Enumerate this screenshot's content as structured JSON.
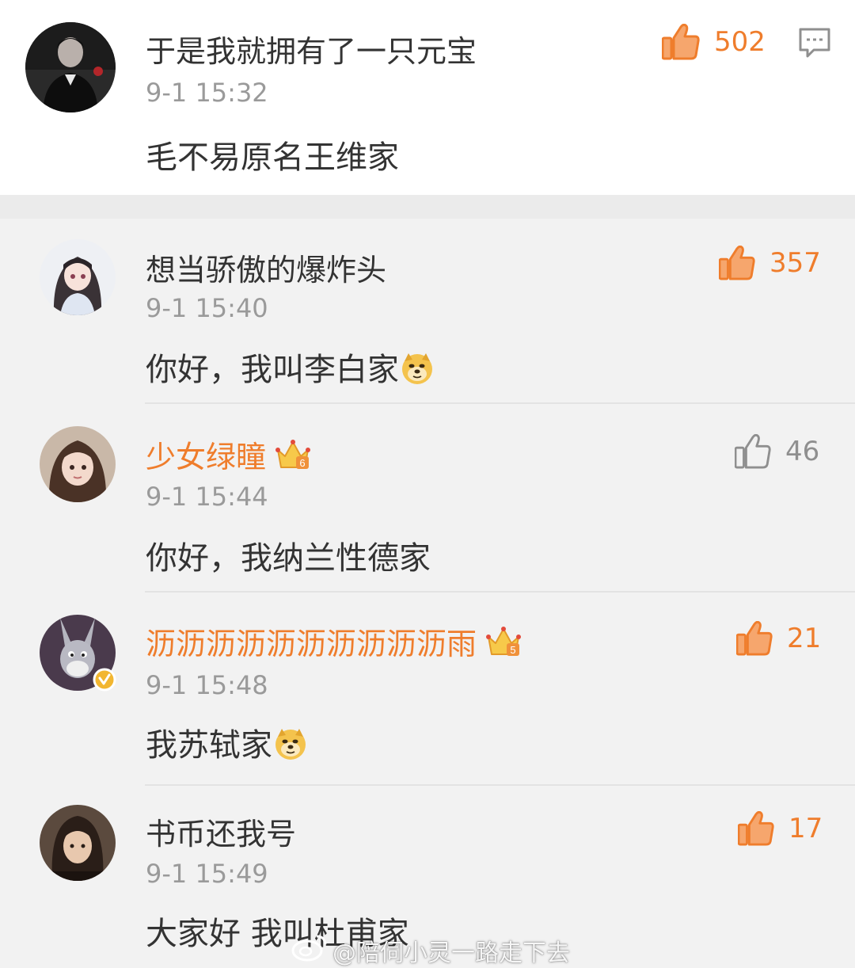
{
  "main_comment": {
    "username": "于是我就拥有了一只元宝",
    "time": "9-1 15:32",
    "text": "毛不易原名王维家",
    "likes": "502"
  },
  "replies": [
    {
      "username": "想当骄傲的爆炸头",
      "vip": false,
      "time": "9-1 15:40",
      "text": "你好，我叫李白家",
      "emoji": "doge-emoji",
      "likes": "357",
      "liked": true
    },
    {
      "username": "少女绿瞳",
      "vip": true,
      "vip_level": "6",
      "time": "9-1 15:44",
      "text": "你好，我纳兰性德家",
      "likes": "46",
      "liked": false
    },
    {
      "username": "沥沥沥沥沥沥沥沥沥沥雨",
      "vip": true,
      "vip_level": "5",
      "verified": true,
      "time": "9-1 15:48",
      "text": "我苏轼家",
      "emoji": "doge-emoji",
      "likes": "21",
      "liked": true
    },
    {
      "username": "书币还我号",
      "vip": false,
      "time": "9-1 15:49",
      "text": "大家好 我叫杜甫家",
      "likes": "17",
      "liked": true
    }
  ],
  "watermark": "@陪伺小灵一路走下去",
  "colors": {
    "accent": "#ef7d2c",
    "text": "#333333",
    "meta": "#9a9a9a"
  }
}
